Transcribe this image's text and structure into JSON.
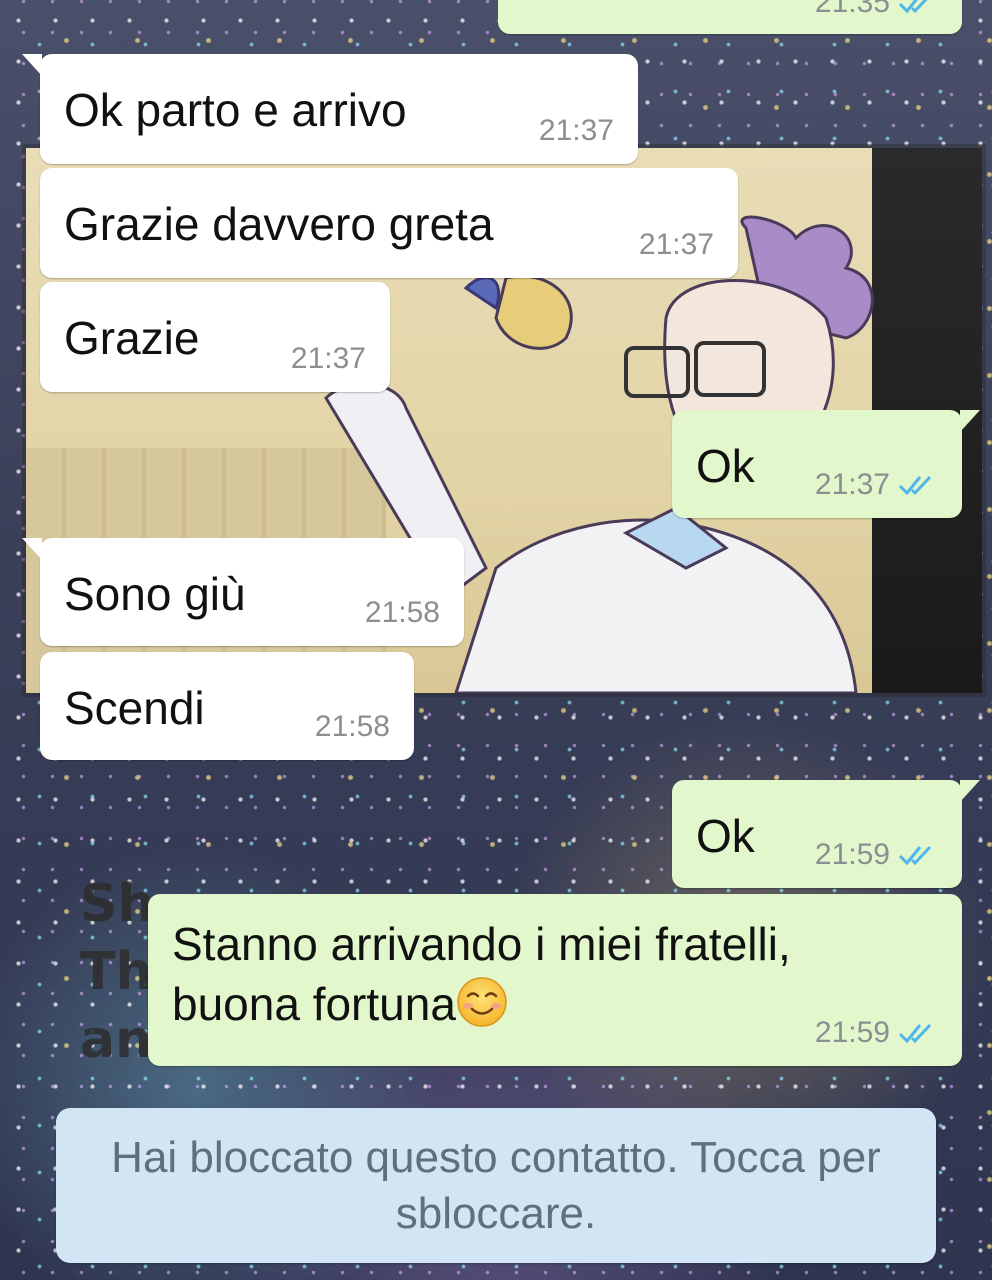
{
  "background_caption": [
    "Sh",
    "Th",
    "an"
  ],
  "messages": [
    {
      "direction": "out",
      "text": "",
      "time": "21:35",
      "ticks": "read"
    },
    {
      "direction": "in",
      "text": "Ok parto e arrivo",
      "time": "21:37"
    },
    {
      "direction": "in",
      "text": "Grazie davvero greta",
      "time": "21:37"
    },
    {
      "direction": "in",
      "text": "Grazie",
      "time": "21:37"
    },
    {
      "direction": "out",
      "text": "Ok",
      "time": "21:37",
      "ticks": "read"
    },
    {
      "direction": "in",
      "text": "Sono giù",
      "time": "21:58"
    },
    {
      "direction": "in",
      "text": "Scendi",
      "time": "21:58"
    },
    {
      "direction": "out",
      "text": "Ok",
      "time": "21:59",
      "ticks": "read"
    },
    {
      "direction": "out",
      "text_lines": [
        "Stanno arrivando i miei fratelli,",
        "buona fortuna"
      ],
      "emoji": "smiling-face-emoji",
      "time": "21:59",
      "ticks": "read"
    }
  ],
  "blocked_notice": {
    "text": "Hai bloccato questo contatto. Tocca per sbloccare."
  },
  "colors": {
    "incoming_bubble": "#ffffff",
    "outgoing_bubble": "#e2f7cb",
    "timestamp": "#8a8f93",
    "read_ticks": "#4fb6ec",
    "notice_bg": "#d1e5f4",
    "notice_text": "#5f6f7c"
  }
}
